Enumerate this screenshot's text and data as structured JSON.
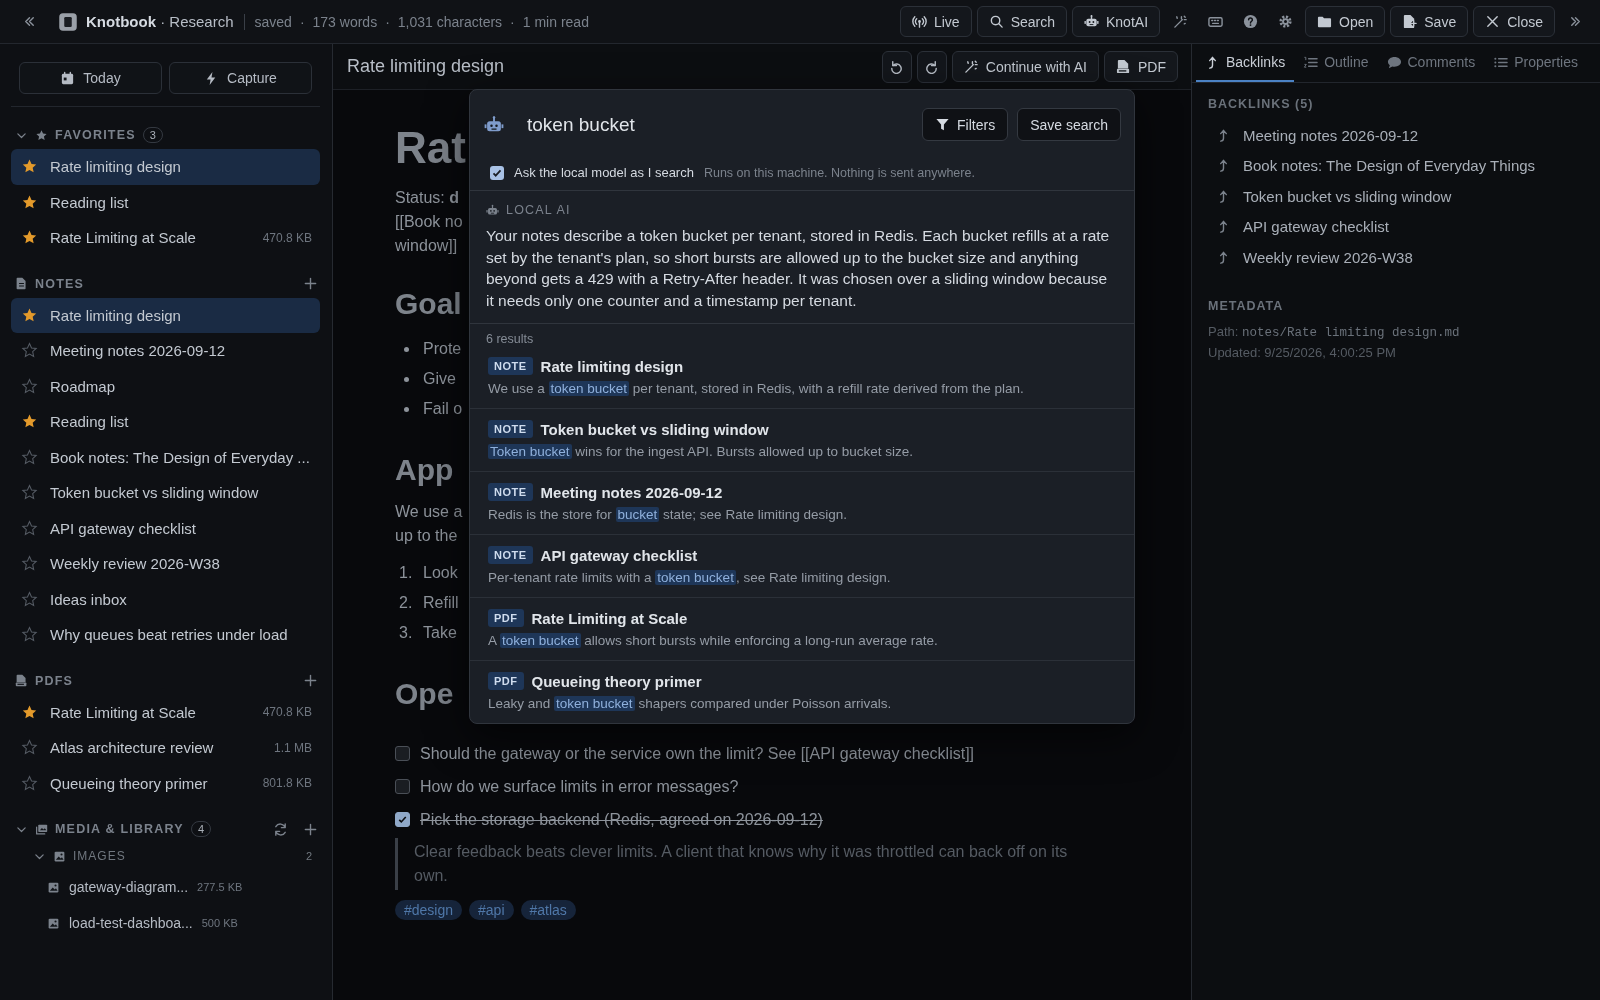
{
  "app": {
    "name": "Knotbook",
    "workspace": "Research",
    "separator": "·",
    "status": [
      "saved",
      "173 words",
      "1,031 characters",
      "1 min read"
    ]
  },
  "toolbar": [
    {
      "kind": "labeled",
      "label": "Live"
    },
    {
      "kind": "labeled",
      "label": "Search"
    },
    {
      "kind": "labeled",
      "label": "KnotAI"
    },
    {
      "kind": "plain"
    },
    {
      "kind": "plain"
    },
    {
      "kind": "plain"
    },
    {
      "kind": "plain"
    },
    {
      "kind": "labeled",
      "label": "Open"
    },
    {
      "kind": "labeled",
      "label": "Save"
    },
    {
      "kind": "labeled",
      "label": "Close"
    }
  ],
  "sidebar": {
    "quick_actions": [
      "Today",
      "Capture"
    ],
    "sections": [
      {
        "title": "FAVORITES",
        "count": "3",
        "expanded": true,
        "items": [
          {
            "label": "Rate limiting design",
            "starred": true,
            "selected": true
          },
          {
            "label": "Reading list",
            "starred": true,
            "selected": false
          },
          {
            "label": "Rate Limiting at Scale",
            "starred": true,
            "selected": false,
            "size": "470.8 KB"
          }
        ]
      },
      {
        "title": "NOTES",
        "addable": true,
        "items": [
          {
            "label": "Rate limiting design",
            "starred": true,
            "selected": true
          },
          {
            "label": "Meeting notes 2026-09-12",
            "starred": false,
            "selected": false
          },
          {
            "label": "Roadmap",
            "starred": false,
            "selected": false
          },
          {
            "label": "Reading list",
            "starred": true,
            "selected": false
          },
          {
            "label": "Book notes: The Design of Everyday ...",
            "starred": false,
            "selected": false
          },
          {
            "label": "Token bucket vs sliding window",
            "starred": false,
            "selected": false
          },
          {
            "label": "API gateway checklist",
            "starred": false,
            "selected": false
          },
          {
            "label": "Weekly review 2026-W38",
            "starred": false,
            "selected": false
          },
          {
            "label": "Ideas inbox",
            "starred": false,
            "selected": false
          },
          {
            "label": "Why queues beat retries under load",
            "starred": false,
            "selected": false
          }
        ]
      },
      {
        "title": "PDFS",
        "addable": true,
        "items": [
          {
            "label": "Rate Limiting at Scale",
            "starred": true,
            "selected": false,
            "size": "470.8 KB"
          },
          {
            "label": "Atlas architecture review",
            "starred": false,
            "selected": false,
            "size": "1.1 MB"
          },
          {
            "label": "Queueing theory primer",
            "starred": false,
            "selected": false,
            "size": "801.8 KB"
          }
        ]
      }
    ],
    "media": {
      "title": "MEDIA & LIBRARY",
      "count": "4",
      "expanded": true,
      "groups": [
        {
          "title": "IMAGES",
          "count": "2",
          "expanded": true,
          "items": [
            {
              "name": "gateway-diagram...",
              "size": "277.5 KB"
            },
            {
              "name": "load-test-dashboa...",
              "size": "500 KB"
            }
          ]
        }
      ]
    }
  },
  "editor": {
    "title": "Rate limiting design",
    "actions": [
      "Continue with AI",
      "PDF"
    ],
    "blocks": [
      {
        "kind": "h1",
        "text": "Rat"
      },
      {
        "kind": "lines",
        "lines": [
          "Status: **d**",
          "[[Book no",
          "window]]"
        ]
      },
      {
        "kind": "h2",
        "text": "Goal"
      },
      {
        "kind": "bullets",
        "items": [
          "Prote",
          "Give",
          "Fail o"
        ]
      },
      {
        "kind": "h2",
        "text": "App"
      },
      {
        "kind": "lines",
        "lines": [
          "We use a",
          "up to the"
        ]
      },
      {
        "kind": "numbered",
        "items": [
          {
            "marker": "1.",
            "text": "Look"
          },
          {
            "marker": "2.",
            "text": "Refill"
          },
          {
            "marker": "3.",
            "text": "Take"
          }
        ]
      },
      {
        "kind": "h2",
        "text": "Ope"
      },
      {
        "kind": "checklist",
        "items": [
          {
            "text": "Should the gateway or the service own the limit? See [[API gateway checklist]]",
            "checked": false
          },
          {
            "text": "How do we surface limits in error messages?",
            "checked": false
          },
          {
            "text": "Pick the storage backend (Redis, agreed on 2026-09-12)",
            "checked": true
          }
        ]
      },
      {
        "kind": "quote",
        "text": "Clear feedback beats clever limits. A client that knows why it was throttled can back off on its own."
      },
      {
        "kind": "tags",
        "items": [
          "#design",
          "#api",
          "#atlas"
        ]
      }
    ]
  },
  "search_modal": {
    "query": "token bucket",
    "buttons": [
      "Filters",
      "Save search"
    ],
    "ai_toggle": {
      "label": "Ask the local model as I search",
      "hint": "Runs on this machine. Nothing is sent anywhere.",
      "checked": true
    },
    "ai_answer": {
      "label": "LOCAL AI",
      "text": "Your notes describe a token bucket per tenant, stored in Redis. Each bucket refills at a rate set by the tenant's plan, so short bursts are allowed up to the bucket size and anything beyond gets a 429 with a Retry-After header. It was chosen over a sliding window because it needs only one counter and a timestamp per tenant."
    },
    "results_count": "6 results",
    "results": [
      {
        "type": "NOTE",
        "title": "Rate limiting design",
        "snippet": {
          "before": "We use a ",
          "match": "token bucket",
          "after": " per tenant, stored in Redis, with a refill rate derived from the plan."
        }
      },
      {
        "type": "NOTE",
        "title": "Token bucket vs sliding window",
        "snippet": {
          "match": "Token bucket",
          "after": " wins for the ingest API. Bursts allowed up to bucket size."
        }
      },
      {
        "type": "NOTE",
        "title": "Meeting notes 2026-09-12",
        "snippet": {
          "before": "Redis is the store for ",
          "match": "bucket",
          "after": " state; see Rate limiting design."
        }
      },
      {
        "type": "NOTE",
        "title": "API gateway checklist",
        "snippet": {
          "before": "Per-tenant rate limits with a ",
          "match": "token bucket",
          "after": ", see Rate limiting design."
        }
      },
      {
        "type": "PDF",
        "title": "Rate Limiting at Scale",
        "snippet": {
          "before": "A ",
          "match": "token bucket",
          "after": " allows short bursts while enforcing a long-run average rate."
        }
      },
      {
        "type": "PDF",
        "title": "Queueing theory primer",
        "snippet": {
          "before": "Leaky and ",
          "match": "token bucket",
          "after": " shapers compared under Poisson arrivals."
        }
      }
    ]
  },
  "right_panel": {
    "tabs": [
      {
        "label": "Backlinks",
        "selected": true
      },
      {
        "label": "Outline",
        "selected": false
      },
      {
        "label": "Comments",
        "selected": false
      },
      {
        "label": "Properties",
        "selected": false
      }
    ],
    "backlinks": {
      "title": "BACKLINKS (5)",
      "items": [
        "Meeting notes 2026-09-12",
        "Book notes: The Design of Everyday Things",
        "Token bucket vs sliding window",
        "API gateway checklist",
        "Weekly review 2026-W38"
      ]
    },
    "metadata": {
      "title": "METADATA",
      "path_label": "Path:",
      "path": "notes/Rate limiting design.md",
      "updated": "Updated: 9/25/2026, 4:00:25 PM"
    }
  }
}
